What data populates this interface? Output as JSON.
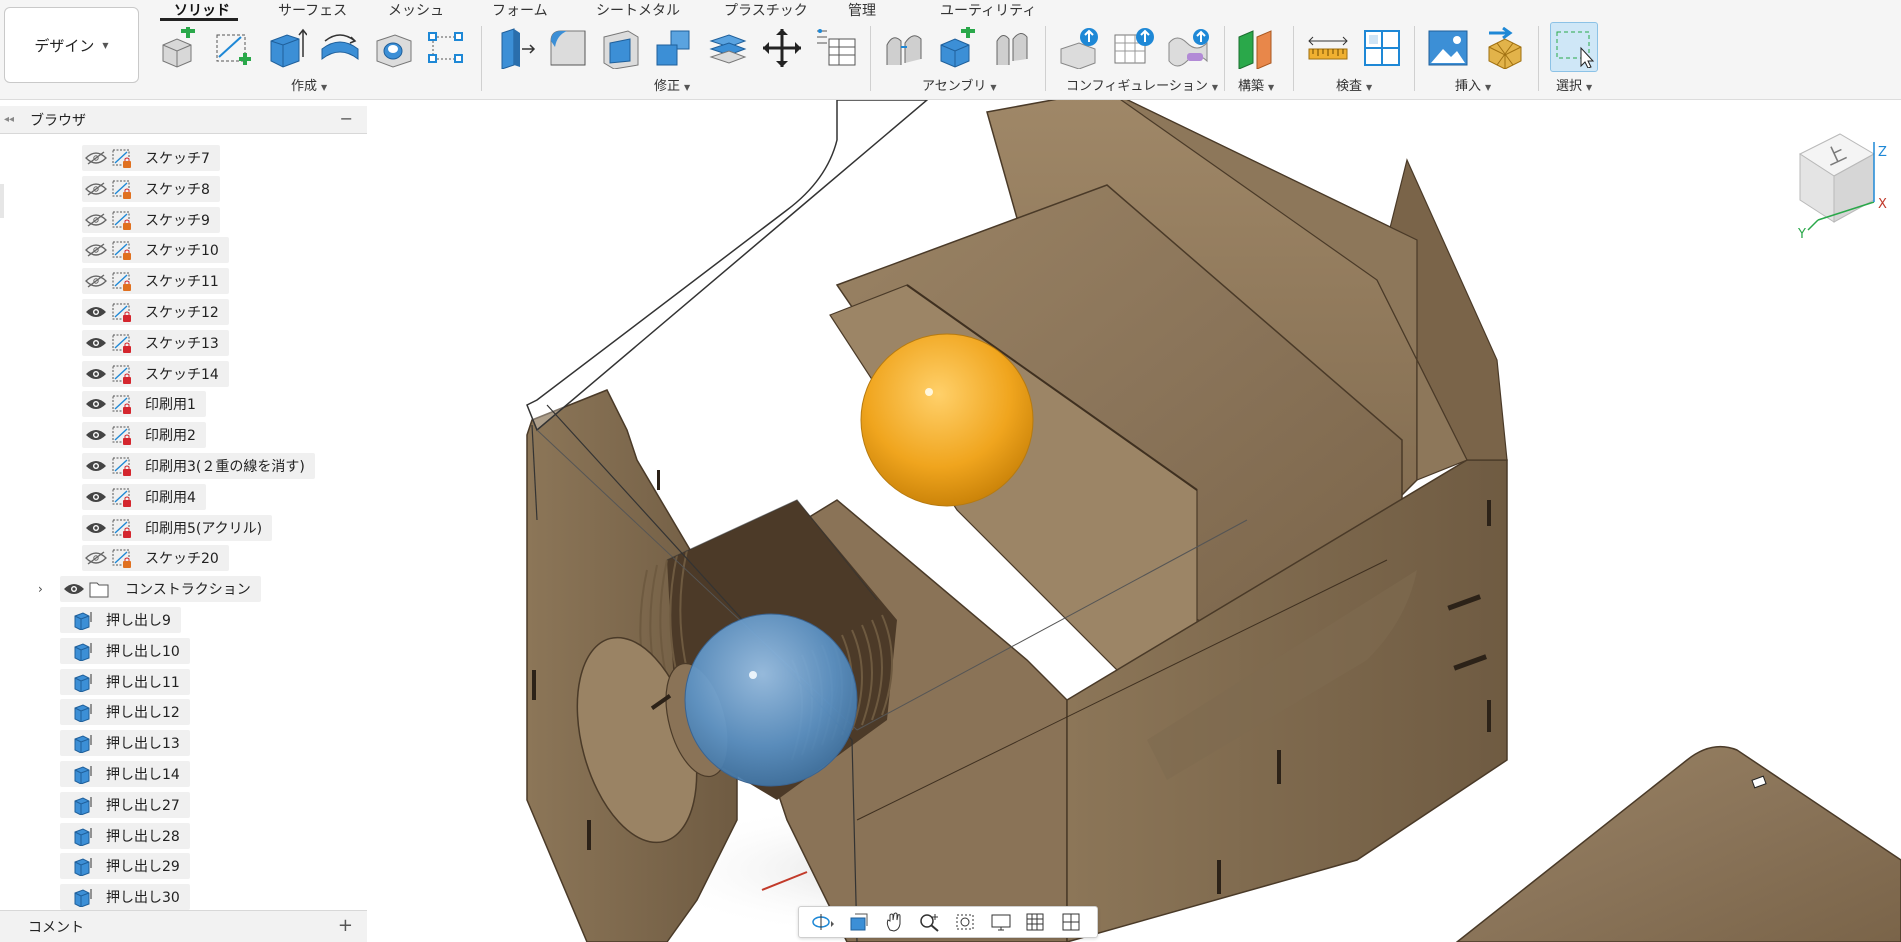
{
  "workspace": {
    "label": "デザイン"
  },
  "tabs": [
    {
      "label": "ソリッド",
      "active": true
    },
    {
      "label": "サーフェス"
    },
    {
      "label": "メッシュ"
    },
    {
      "label": "フォーム"
    },
    {
      "label": "シートメタル"
    },
    {
      "label": "プラスチック"
    },
    {
      "label": "管理"
    },
    {
      "label": "ユーティリティ"
    }
  ],
  "groups": {
    "create": "作成",
    "modify": "修正",
    "assemble": "アセンブリ",
    "configure": "コンフィギュレーション",
    "construct": "構築",
    "inspect": "検査",
    "insert": "挿入",
    "select": "選択"
  },
  "icons": {
    "new_component": "new-component-icon",
    "create_sketch": "create-sketch-icon",
    "extrude": "extrude-icon",
    "revolve": "revolve-icon",
    "hole": "hole-icon",
    "pattern": "pattern-icon",
    "press_pull": "press-pull-icon",
    "fillet": "fillet-icon",
    "shell": "shell-icon",
    "combine": "combine-icon",
    "split_face": "stack-icon",
    "move": "move-icon",
    "table": "parameters-table-icon",
    "joint": "joint-icon",
    "new_component_2": "assembly-new-component-icon",
    "rigid": "rigid-group-icon",
    "config1": "configure-icon",
    "config2": "configure-table-icon",
    "config3": "configure-rule-icon",
    "plane": "offset-plane-icon",
    "measure": "measure-icon",
    "section": "section-analysis-icon",
    "image": "insert-image-icon",
    "mesh": "insert-mesh-icon",
    "select": "select-window-icon"
  },
  "browser": {
    "title": "ブラウザ",
    "sketches": [
      {
        "label": "スケッチ7",
        "visible": false
      },
      {
        "label": "スケッチ8",
        "visible": false
      },
      {
        "label": "スケッチ9",
        "visible": false
      },
      {
        "label": "スケッチ10",
        "visible": false
      },
      {
        "label": "スケッチ11",
        "visible": false
      },
      {
        "label": "スケッチ12",
        "visible": true
      },
      {
        "label": "スケッチ13",
        "visible": true
      },
      {
        "label": "スケッチ14",
        "visible": true
      },
      {
        "label": "印刷用1",
        "visible": true
      },
      {
        "label": "印刷用2",
        "visible": true
      },
      {
        "label": "印刷用3(２重の線を消す)",
        "visible": true
      },
      {
        "label": "印刷用4",
        "visible": true
      },
      {
        "label": "印刷用5(アクリル)",
        "visible": true
      },
      {
        "label": "スケッチ20",
        "visible": false
      }
    ],
    "construction": {
      "label": "コンストラクション"
    },
    "features": [
      {
        "label": "押し出し9"
      },
      {
        "label": "押し出し10"
      },
      {
        "label": "押し出し11"
      },
      {
        "label": "押し出し12"
      },
      {
        "label": "押し出し13"
      },
      {
        "label": "押し出し14"
      },
      {
        "label": "押し出し27"
      },
      {
        "label": "押し出し28"
      },
      {
        "label": "押し出し29"
      },
      {
        "label": "押し出し30"
      }
    ]
  },
  "comments": {
    "title": "コメント"
  },
  "viewcube": {
    "face_label": "上",
    "axes": [
      "X",
      "Y",
      "Z"
    ]
  },
  "colors": {
    "wood": "#8a7459",
    "wood_dark": "#6b5740",
    "orange_ball": "#f0a51e",
    "blue_ball": "#5b93c7",
    "accent": "#1e88d6"
  }
}
